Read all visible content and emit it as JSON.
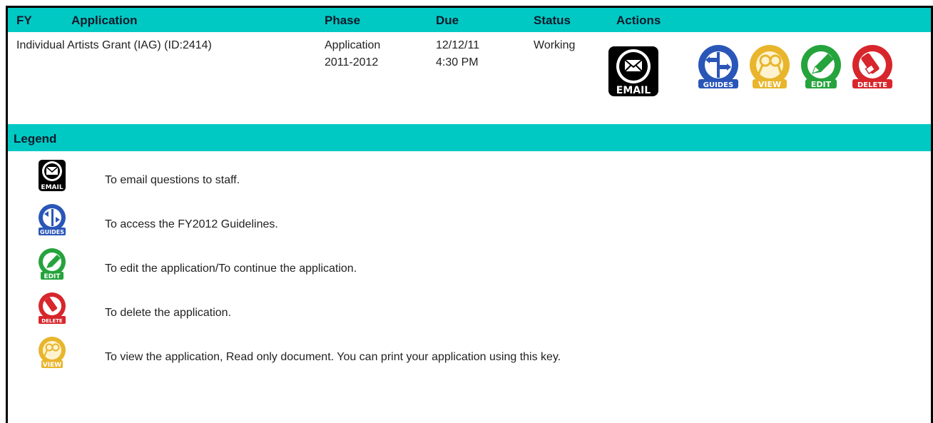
{
  "table": {
    "headers": {
      "fy": "FY",
      "application": "Application",
      "phase": "Phase",
      "due": "Due",
      "status": "Status",
      "actions": "Actions"
    },
    "row": {
      "application": "Individual Artists Grant (IAG) (ID:2414)",
      "phase_line1": "Application",
      "phase_line2": "2011-2012",
      "due_line1": "12/12/11",
      "due_line2": "4:30 PM",
      "status": "Working"
    },
    "action_icons": [
      {
        "name": "email-icon",
        "label": "EMAIL",
        "color": "#000000"
      },
      {
        "name": "guides-icon",
        "label": "GUIDES",
        "color": "#2a56b8"
      },
      {
        "name": "view-icon",
        "label": "VIEW",
        "color": "#e8b52c"
      },
      {
        "name": "edit-icon",
        "label": "EDIT",
        "color": "#25a33c"
      },
      {
        "name": "delete-icon",
        "label": "DELETE",
        "color": "#d7262c"
      }
    ]
  },
  "legend": {
    "title": "Legend",
    "items": [
      {
        "icon": "email-icon",
        "text": "To email questions to staff."
      },
      {
        "icon": "guides-icon",
        "text": "To access the FY2012 Guidelines."
      },
      {
        "icon": "edit-icon",
        "text": "To edit the application/To continue the application."
      },
      {
        "icon": "delete-icon",
        "text": "To delete the application."
      },
      {
        "icon": "view-icon",
        "text": "To view the application, Read only document. You can print your application using this key."
      }
    ]
  },
  "colors": {
    "header_bg": "#00c9c4",
    "border": "#000000"
  }
}
